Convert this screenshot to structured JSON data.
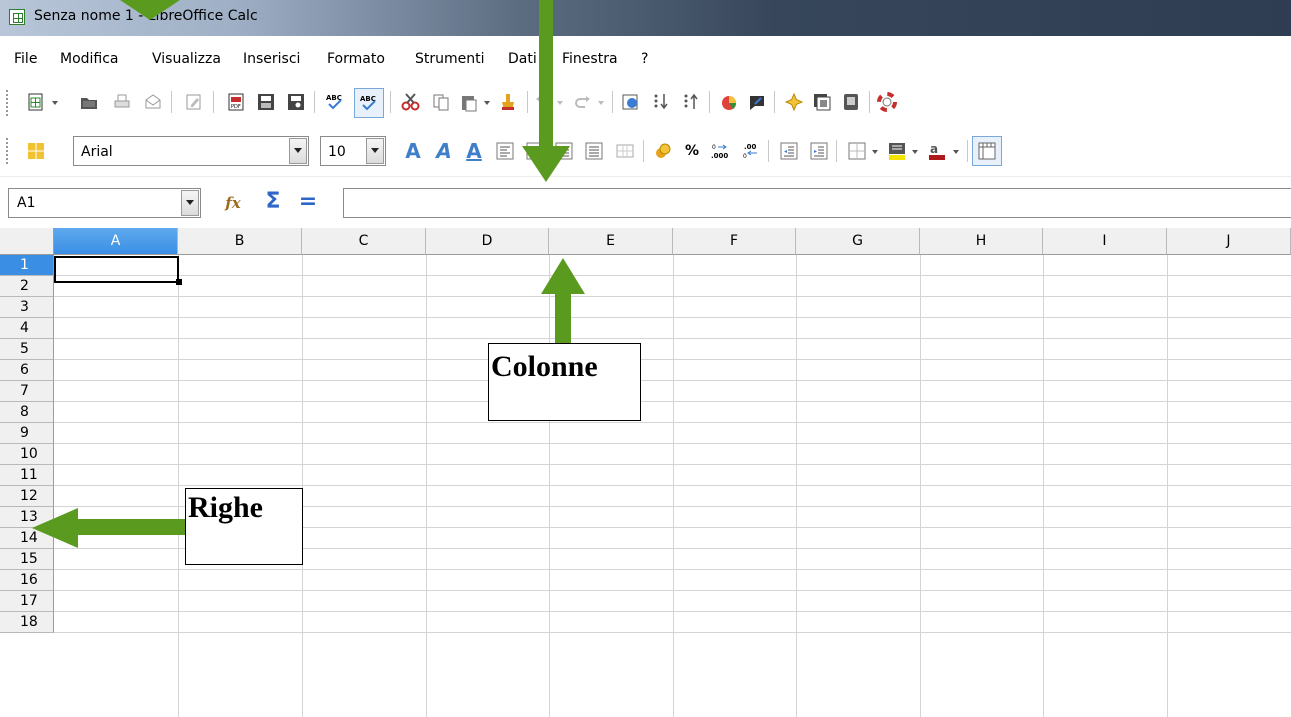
{
  "window": {
    "title": "Senza nome 1 - LibreOffice Calc"
  },
  "menu": [
    "File",
    "Modifica",
    "Visualizza",
    "Inserisci",
    "Formato",
    "Strumenti",
    "Dati",
    "Finestra",
    "?"
  ],
  "toolbar_standard": [
    "new-document-icon",
    "open-folder-icon",
    "print-icon",
    "email-icon",
    "edit-mode-icon",
    "export-pdf-icon",
    "save-icon",
    "print-preview-icon",
    "spellcheck-icon",
    "autospellcheck-icon",
    "cut-icon",
    "copy-icon",
    "paste-icon",
    "clone-formatting-icon",
    "undo-icon",
    "redo-icon",
    "hyperlink-icon",
    "sort-ascending-icon",
    "sort-descending-icon",
    "chart-icon",
    "draw-functions-icon",
    "navigator-icon",
    "gallery-icon",
    "data-sources-icon",
    "help-icon"
  ],
  "formatting": {
    "font_name": "Arial",
    "font_size": "10",
    "buttons": [
      "bold-icon",
      "italic-icon",
      "underline-icon",
      "align-left-icon",
      "align-center-icon",
      "align-right-icon",
      "justify-icon",
      "merge-cells-icon",
      "currency-icon",
      "percent-icon",
      "add-decimal-icon",
      "delete-decimal-icon",
      "decrease-indent-icon",
      "increase-indent-icon",
      "borders-icon",
      "background-color-icon",
      "font-color-icon",
      "toggle-grid-icon"
    ]
  },
  "formula_bar": {
    "name_box": "A1",
    "function_wizard_icon": "fx",
    "sum_symbol": "Σ",
    "equals_symbol": "=",
    "input": ""
  },
  "grid": {
    "columns": [
      "A",
      "B",
      "C",
      "D",
      "E",
      "F",
      "G",
      "H",
      "I",
      "J"
    ],
    "rows": [
      "1",
      "2",
      "3",
      "4",
      "5",
      "6",
      "7",
      "8",
      "9",
      "10",
      "11",
      "12",
      "13",
      "14",
      "15",
      "16",
      "17",
      "18"
    ],
    "active_cell": "A1"
  },
  "annotations": {
    "columns_label": "Colonne",
    "rows_label": "Righe",
    "arrow_color": "#5a9a1e"
  }
}
